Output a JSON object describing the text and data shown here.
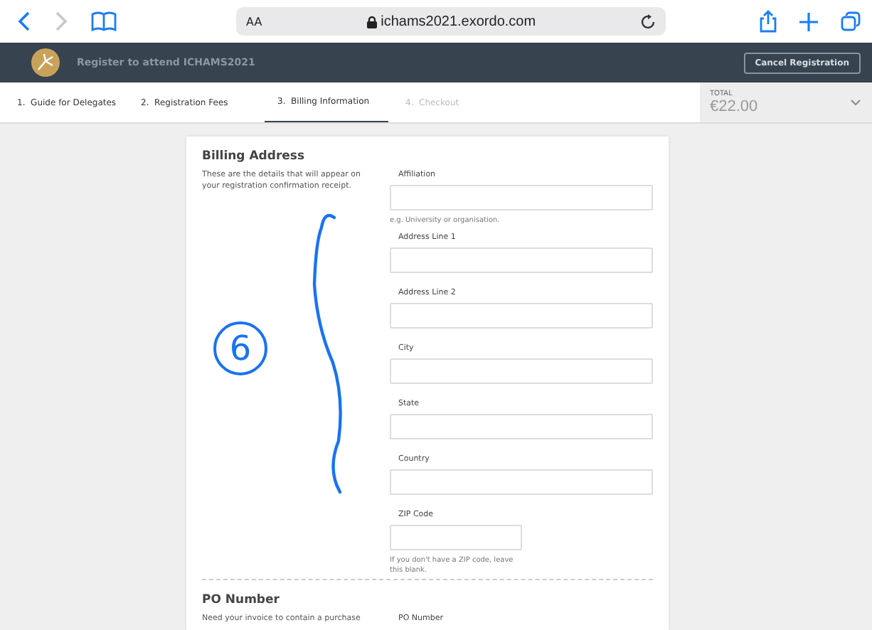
{
  "browser": {
    "text_size": "AA",
    "url": "ichams2021.exordo.com"
  },
  "header": {
    "title": "Register to attend ICHAMS2021",
    "cancel_button": "Cancel Registration"
  },
  "steps": [
    {
      "label": "1.  Guide for Delegates",
      "selected": false,
      "disabled": false
    },
    {
      "label": "2.  Registration Fees",
      "selected": false,
      "disabled": false
    },
    {
      "label": "3.  Billing Information",
      "selected": true,
      "disabled": false
    },
    {
      "label": "4.  Checkout",
      "selected": false,
      "disabled": true
    }
  ],
  "total": {
    "label": "TOTAL",
    "amount": "€22.00"
  },
  "billing": {
    "title": "Billing Address",
    "description": "These are the details that will appear on your registration confirmation receipt.",
    "fields": [
      {
        "label": "Affiliation",
        "hint": "e.g. University or organisation.",
        "kind": "wide"
      },
      {
        "label": "Address Line 1",
        "kind": "wide"
      },
      {
        "label": "Address Line 2",
        "kind": "wide"
      },
      {
        "label": "City",
        "kind": "wide"
      },
      {
        "label": "State",
        "kind": "wide"
      },
      {
        "label": "Country",
        "kind": "wide"
      },
      {
        "label": "ZIP Code",
        "hint": "If you don't have a ZIP code, leave this blank.",
        "kind": "short"
      }
    ]
  },
  "po": {
    "title": "PO Number",
    "description": "Need your invoice to contain a purchase",
    "field_label": "PO Number"
  },
  "annotation": {
    "number": "6"
  }
}
